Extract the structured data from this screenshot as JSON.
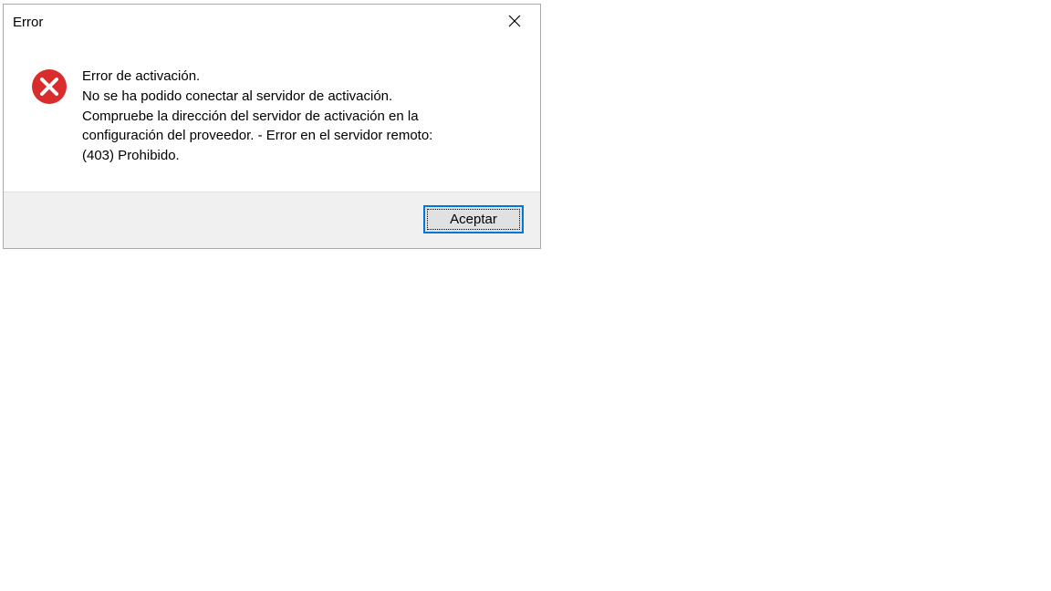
{
  "dialog": {
    "title": "Error",
    "message": "Error de activación.\nNo se ha podido conectar al servidor de activación.\nCompruebe la dirección del servidor de activación en la\nconfiguración del proveedor. - Error en el servidor remoto:\n(403) Prohibido.",
    "accept_label": "Aceptar"
  }
}
